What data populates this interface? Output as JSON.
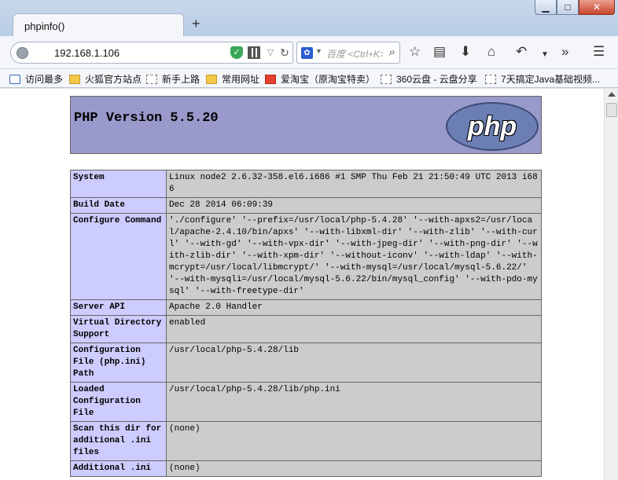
{
  "browser": {
    "tab_title": "phpinfo()",
    "new_tab": "+",
    "url": "192.168.1.106",
    "search_placeholder": "百度 <Ctrl+K>",
    "window_controls": {
      "minimize": "▁",
      "maximize": "□",
      "close": "✕"
    },
    "toolbar_icons": [
      "star-icon",
      "reading-list-icon",
      "download-icon",
      "home-icon",
      "back-icon",
      "chevron-down-icon",
      "overflow-icon",
      "menu-icon"
    ]
  },
  "bookmarks": [
    {
      "label": "访问最多",
      "icon": "magnifier"
    },
    {
      "label": "火狐官方站点",
      "icon": "folder"
    },
    {
      "label": "新手上路",
      "icon": "page"
    },
    {
      "label": "常用网址",
      "icon": "folder"
    },
    {
      "label": "爱淘宝（原淘宝特卖）",
      "icon": "taobao"
    },
    {
      "label": "360云盘 - 云盘分享",
      "icon": "page"
    },
    {
      "label": "7天搞定Java基础视频...",
      "icon": "page"
    }
  ],
  "phpinfo": {
    "version": "PHP Version 5.5.20",
    "logo": "php",
    "rows": [
      {
        "key": "System",
        "value": "Linux node2 2.6.32-358.el6.i686 #1 SMP Thu Feb 21 21:50:49 UTC 2013 i686"
      },
      {
        "key": "Build Date",
        "value": "Dec 28 2014 06:09:39"
      },
      {
        "key": "Configure Command",
        "value": "'./configure' '--prefix=/usr/local/php-5.4.28' '--with-apxs2=/usr/local/apache-2.4.10/bin/apxs' '--with-libxml-dir' '--with-zlib' '--with-curl' '--with-gd' '--with-vpx-dir' '--with-jpeg-dir' '--with-png-dir' '--with-zlib-dir' '--with-xpm-dir' '--without-iconv' '--with-ldap' '--with-mcrypt=/usr/local/libmcrypt/' '--with-mysql=/usr/local/mysql-5.6.22/' '--with-mysqli=/usr/local/mysql-5.6.22/bin/mysql_config' '--with-pdo-mysql' '--with-freetype-dir'"
      },
      {
        "key": "Server API",
        "value": "Apache 2.0 Handler"
      },
      {
        "key": "Virtual Directory Support",
        "value": "enabled"
      },
      {
        "key": "Configuration File (php.ini) Path",
        "value": "/usr/local/php-5.4.28/lib"
      },
      {
        "key": "Loaded Configuration File",
        "value": "/usr/local/php-5.4.28/lib/php.ini"
      },
      {
        "key": "Scan this dir for additional .ini files",
        "value": "(none)"
      },
      {
        "key": "Additional .ini",
        "value": "(none)"
      }
    ]
  }
}
